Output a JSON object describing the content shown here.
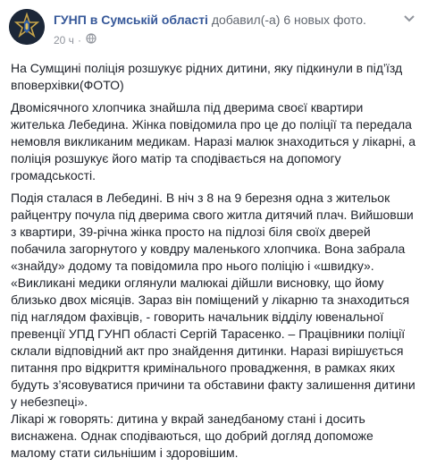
{
  "post": {
    "author": "ГУНП в Сумській області",
    "action": "добавил(-а) 6 новых фото.",
    "time": "20 ч",
    "visibility_icon": "globe-icon",
    "menu_icon": "chevron-down-icon",
    "paragraphs": [
      "На Сумщині поліція розшукує рідних дитини, яку підкинули в під’їзд вповерхівки(ФОТО)",
      "Двомісячного хлопчика знайшла під дверима своєї квартири жителька Лебедина. Жінка повідомила про це до поліції та передала немовля викликаним медикам. Наразі малюк знаходиться у лікарні, а поліція розшукує його матір та сподівається на допомогу громадськості.",
      "Подія сталася в Лебедині. В ніч з 8 на 9 березня одна з жительок райцентру почула під дверима свого житла дитячий плач. Вийшовши з квартири, 39-річна жінка просто на підлозі біля своїх дверей побачила загорнутого у ковдру маленького хлопчика. Вона забрала «знайду» додому та повідомила про нього поліцію і «швидку».\n«Викликані медики оглянули малюкаі дійшли висновку, що йому близько двох місяців. Зараз він поміщений у лікарню та знаходиться під наглядом фахівців, - говорить начальник відділу ювенальної превенції УПД ГУНП області Сергій Тарасенко. – Працівники поліції склали відповідний акт про знайдення дитинки. Наразі вирішується питання про відкриття кримінального провадження, в рамках яких будуть з’ясовуватися причини та обставини факту залишення дитини у небезпеці».\nЛікарі ж говорять: дитина у вкрай занедбаному стані і досить виснажена. Однак сподіваються, що добрий догляд допоможе малому стати сильнішим і здоровішим."
    ]
  },
  "colors": {
    "link": "#365899",
    "text": "#1d2129",
    "meta": "#90949c",
    "avatar_bg": "#1c2738",
    "badge": "#c8a54a"
  }
}
